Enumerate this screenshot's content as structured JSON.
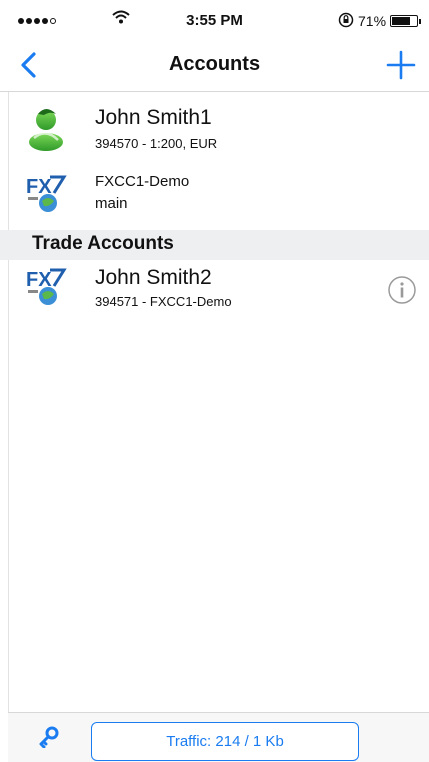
{
  "status_bar": {
    "time": "3:55 PM",
    "battery_pct": "71%",
    "battery_level": 0.71,
    "signal_bars": 4
  },
  "nav": {
    "title": "Accounts"
  },
  "colors": {
    "accent": "#1a7cf0",
    "section_bg": "#eeeff1"
  },
  "current_account": {
    "name": "John Smith1",
    "details": "394570 - 1:200, EUR",
    "icon": "metatrader-user-icon"
  },
  "server": {
    "name": "FXCC1-Demo",
    "group": "main",
    "icon": "fx-globe-icon"
  },
  "trade_section": {
    "title": "Trade Accounts",
    "items": [
      {
        "name": "John Smith2",
        "details": "394571 - FXCC1-Demo",
        "icon": "fx-globe-icon",
        "action_icon": "info-icon"
      }
    ]
  },
  "bottom_bar": {
    "traffic_label": "Traffic: 214 / 1 Kb",
    "key_icon": "key-icon"
  }
}
